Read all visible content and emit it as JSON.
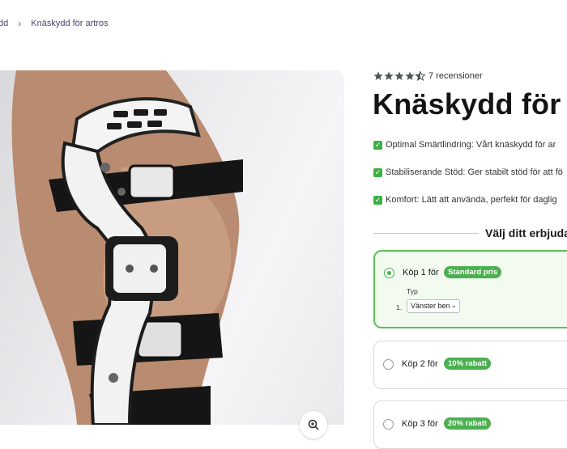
{
  "breadcrumb": {
    "previous": "dd",
    "current": "Knäskydd för artros"
  },
  "product": {
    "rating_text": "7 recensioner",
    "title": "Knäskydd för",
    "features": [
      "Optimal Smärtlindring: Vårt knäskydd för ar",
      "Stabiliserande Stöd: Ger stabilt stöd för att fö",
      "Komfort: Lätt att använda, perfekt för daglig"
    ]
  },
  "offer_section": {
    "heading": "Välj ditt erbjuda",
    "offers": [
      {
        "label": "Köp 1 för",
        "badge": "Standard pris",
        "selected": true
      },
      {
        "label": "Köp 2 för",
        "badge": "10% rabatt",
        "selected": false
      },
      {
        "label": "Köp 3 för",
        "badge": "20% rabatt",
        "selected": false
      }
    ],
    "variant": {
      "label": "Typ",
      "index": "1.",
      "value": "Vänster ben"
    }
  },
  "colors": {
    "accent": "#4caf50",
    "brand_green": "#2f5b48"
  }
}
